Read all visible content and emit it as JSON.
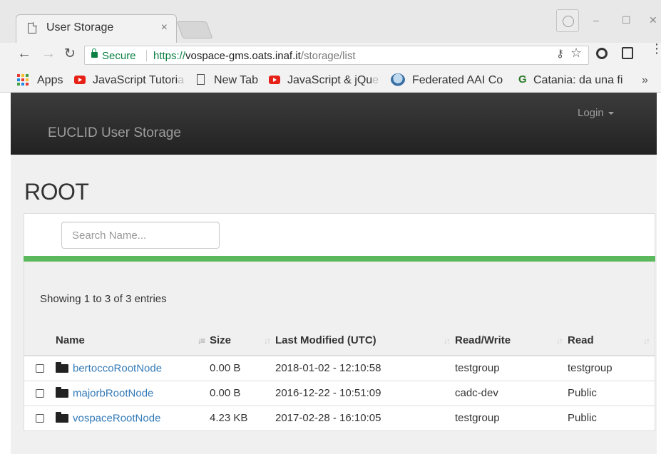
{
  "browser": {
    "tab_title": "User Storage",
    "tab_close": "×",
    "address": {
      "secure_label": "Secure",
      "url_scheme": "https://",
      "url_host": "vospace-gms.oats.inaf.it",
      "url_path": "/storage/list"
    },
    "bookmarks": [
      {
        "label": "Apps",
        "fade": ""
      },
      {
        "label": "JavaScript Tutori",
        "fade": "a"
      },
      {
        "label": "New Tab",
        "fade": ""
      },
      {
        "label": "JavaScript & jQu",
        "fade": "e"
      },
      {
        "label": "Federated AAI Co",
        "fade": ""
      },
      {
        "label": "Catania: da una fi",
        "fade": ""
      }
    ],
    "overflow": "»"
  },
  "navbar": {
    "brand": "EUCLID User Storage",
    "login": "Login"
  },
  "page": {
    "title": "ROOT",
    "search_placeholder": "Search Name...",
    "showing": "Showing 1 to 3 of 3 entries"
  },
  "table": {
    "columns": [
      "Name",
      "Size",
      "Last Modified (UTC)",
      "Read/Write",
      "Read"
    ],
    "rows": [
      {
        "name": "bertoccoRootNode",
        "size": "0.00 B",
        "modified": "2018-01-02 - 12:10:58",
        "read_write": "testgroup",
        "read": "testgroup"
      },
      {
        "name": "majorbRootNode",
        "size": "0.00 B",
        "modified": "2016-12-22 - 10:51:09",
        "read_write": "cadc-dev",
        "read": "Public"
      },
      {
        "name": "vospaceRootNode",
        "size": "4.23 KB",
        "modified": "2017-02-28 - 16:10:05",
        "read_write": "testgroup",
        "read": "Public"
      }
    ]
  },
  "colors": {
    "accent": "#337ab7",
    "progress": "#5cb85c",
    "secure": "#0b8043"
  }
}
